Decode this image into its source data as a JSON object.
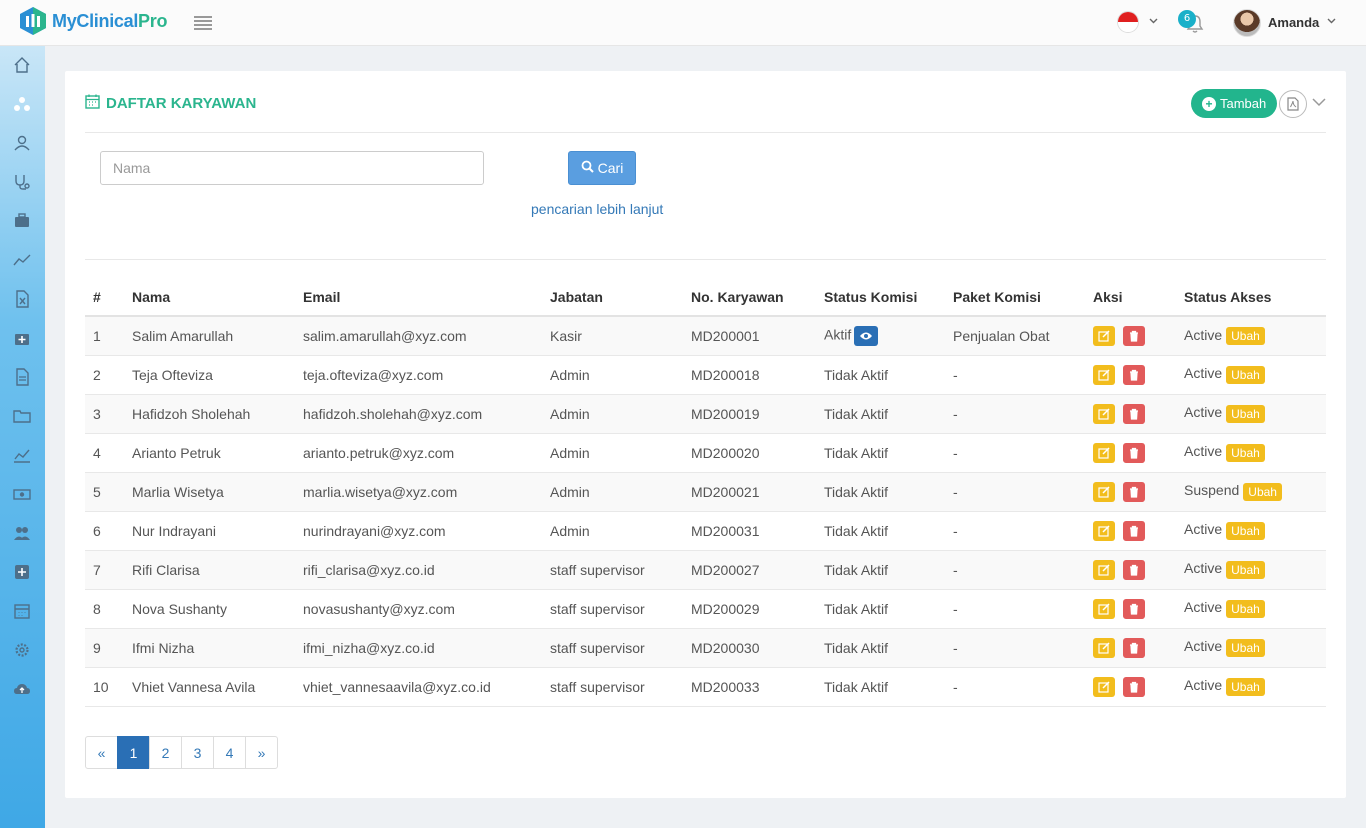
{
  "app": {
    "logo_text_a": "MyClinical",
    "logo_text_b": "Pro",
    "notification_count": "6",
    "username": "Amanda",
    "language": "Indonesia"
  },
  "sidebar": {
    "items": [
      {
        "icon": "home-icon"
      },
      {
        "icon": "sitemap-icon"
      },
      {
        "icon": "user-icon"
      },
      {
        "icon": "stethoscope-icon"
      },
      {
        "icon": "briefcase-icon"
      },
      {
        "icon": "line-chart-icon"
      },
      {
        "icon": "excel-file-icon"
      },
      {
        "icon": "medkit-icon"
      },
      {
        "icon": "document-icon"
      },
      {
        "icon": "folder-icon"
      },
      {
        "icon": "area-chart-icon"
      },
      {
        "icon": "money-icon"
      },
      {
        "icon": "users-icon"
      },
      {
        "icon": "plus-square-icon"
      },
      {
        "icon": "calendar-icon"
      },
      {
        "icon": "gear-icon"
      },
      {
        "icon": "cloud-upload-icon"
      }
    ]
  },
  "page": {
    "title": "DAFTAR KARYAWAN",
    "add_button": "Tambah",
    "search_placeholder": "Nama",
    "search_value": "",
    "search_button": "Cari",
    "advanced_search_link": "pencarian lebih lanjut"
  },
  "table": {
    "headers": [
      "#",
      "Nama",
      "Email",
      "Jabatan",
      "No. Karyawan",
      "Status Komisi",
      "Paket Komisi",
      "Aksi",
      "Status Akses"
    ],
    "update_label": "Ubah",
    "rows": [
      {
        "no": "1",
        "nama": "Salim Amarullah",
        "email": "salim.amarullah@xyz.com",
        "jabatan": "Kasir",
        "no_karyawan": "MD200001",
        "status_komisi": "Aktif",
        "paket_komisi": "Penjualan Obat",
        "status_akses": "Active"
      },
      {
        "no": "2",
        "nama": "Teja Ofteviza",
        "email": "teja.ofteviza@xyz.com",
        "jabatan": "Admin",
        "no_karyawan": "MD200018",
        "status_komisi": "Tidak Aktif",
        "paket_komisi": "-",
        "status_akses": "Active"
      },
      {
        "no": "3",
        "nama": "Hafidzoh Sholehah",
        "email": "hafidzoh.sholehah@xyz.com",
        "jabatan": "Admin",
        "no_karyawan": "MD200019",
        "status_komisi": "Tidak Aktif",
        "paket_komisi": "-",
        "status_akses": "Active"
      },
      {
        "no": "4",
        "nama": "Arianto Petruk",
        "email": "arianto.petruk@xyz.com",
        "jabatan": "Admin",
        "no_karyawan": "MD200020",
        "status_komisi": "Tidak Aktif",
        "paket_komisi": "-",
        "status_akses": "Active"
      },
      {
        "no": "5",
        "nama": "Marlia Wisetya",
        "email": "marlia.wisetya@xyz.com",
        "jabatan": "Admin",
        "no_karyawan": "MD200021",
        "status_komisi": "Tidak Aktif",
        "paket_komisi": "-",
        "status_akses": "Suspend"
      },
      {
        "no": "6",
        "nama": "Nur Indrayani",
        "email": "nurindrayani@xyz.com",
        "jabatan": "Admin",
        "no_karyawan": "MD200031",
        "status_komisi": "Tidak Aktif",
        "paket_komisi": "-",
        "status_akses": "Active"
      },
      {
        "no": "7",
        "nama": "Rifi Clarisa",
        "email": "rifi_clarisa@xyz.co.id",
        "jabatan": "staff supervisor",
        "no_karyawan": "MD200027",
        "status_komisi": "Tidak Aktif",
        "paket_komisi": "-",
        "status_akses": "Active"
      },
      {
        "no": "8",
        "nama": "Nova Sushanty",
        "email": "novasushanty@xyz.com",
        "jabatan": "staff supervisor",
        "no_karyawan": "MD200029",
        "status_komisi": "Tidak Aktif",
        "paket_komisi": "-",
        "status_akses": "Active"
      },
      {
        "no": "9",
        "nama": "Ifmi Nizha",
        "email": "ifmi_nizha@xyz.co.id",
        "jabatan": "staff supervisor",
        "no_karyawan": "MD200030",
        "status_komisi": "Tidak Aktif",
        "paket_komisi": "-",
        "status_akses": "Active"
      },
      {
        "no": "10",
        "nama": "Vhiet Vannesa Avila",
        "email": "vhiet_vannesaavila@xyz.co.id",
        "jabatan": "staff supervisor",
        "no_karyawan": "MD200033",
        "status_komisi": "Tidak Aktif",
        "paket_komisi": "-",
        "status_akses": "Active"
      }
    ]
  },
  "pagination": {
    "prev": "«",
    "pages": [
      "1",
      "2",
      "3",
      "4"
    ],
    "active": "1",
    "next": "»"
  },
  "colors": {
    "brand_green": "#22b58d",
    "brand_blue": "#2a8fd4",
    "primary_button": "#5a9ee0",
    "edit_yellow": "#f2bd1d",
    "delete_red": "#e25a5a",
    "pagination_active": "#2a6fb5"
  }
}
